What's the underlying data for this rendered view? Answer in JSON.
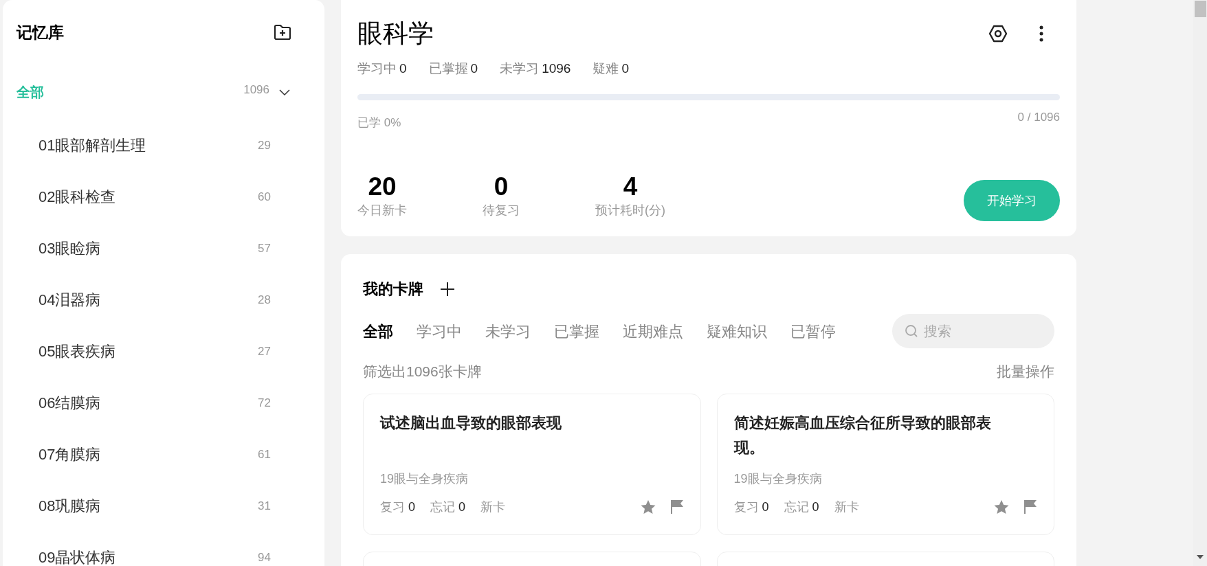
{
  "sidebar": {
    "title": "记忆库",
    "all": {
      "label": "全部",
      "count": "1096",
      "selected": true,
      "expanded": true
    },
    "items": [
      {
        "label": "01眼部解剖生理",
        "count": "29",
        "selected": false
      },
      {
        "label": "02眼科检查",
        "count": "60",
        "selected": false
      },
      {
        "label": "03眼睑病",
        "count": "57",
        "selected": false
      },
      {
        "label": "04泪器病",
        "count": "28",
        "selected": false
      },
      {
        "label": "05眼表疾病",
        "count": "27",
        "selected": false
      },
      {
        "label": "06结膜病",
        "count": "72",
        "selected": false
      },
      {
        "label": "07角膜病",
        "count": "61",
        "selected": false
      },
      {
        "label": "08巩膜病",
        "count": "31",
        "selected": false
      },
      {
        "label": "09晶状体病",
        "count": "94",
        "selected": false
      }
    ]
  },
  "deck": {
    "title": "眼科学",
    "stats": [
      {
        "label": "学习中",
        "value": "0"
      },
      {
        "label": "已掌握",
        "value": "0"
      },
      {
        "label": "未学习",
        "value": "1096"
      },
      {
        "label": "疑难",
        "value": "0"
      }
    ],
    "progress": {
      "level": 0,
      "learned": "已学 0%",
      "count": "0 / 1096"
    },
    "metrics": [
      {
        "value": "20",
        "label": "今日新卡"
      },
      {
        "value": "0",
        "label": "待复习"
      },
      {
        "value": "4",
        "label": "预计耗时(分)"
      }
    ],
    "start_button": "开始学习"
  },
  "cards_section": {
    "title": "我的卡牌",
    "tabs": [
      {
        "label": "全部",
        "selected": true
      },
      {
        "label": "学习中",
        "selected": false
      },
      {
        "label": "未学习",
        "selected": false
      },
      {
        "label": "已掌握",
        "selected": false
      },
      {
        "label": "近期难点",
        "selected": false
      },
      {
        "label": "疑难知识",
        "selected": false
      },
      {
        "label": "已暂停",
        "selected": false
      }
    ],
    "search": {
      "placeholder": "搜索"
    },
    "filter_text": "筛选出1096张卡牌",
    "bulk_action": "批量操作",
    "cards": [
      {
        "question": "试述脑出血导致的眼部表现",
        "category": "19眼与全身疾病",
        "review_label": "复习",
        "review_count": "0",
        "forget_label": "忘记",
        "forget_count": "0",
        "status": "新卡",
        "starred": false,
        "flagged": false
      },
      {
        "question": "简述妊娠高血压综合征所导致的眼部表现。",
        "category": "19眼与全身疾病",
        "review_label": "复习",
        "review_count": "0",
        "forget_label": "忘记",
        "forget_count": "0",
        "status": "新卡",
        "starred": false,
        "flagged": false
      }
    ]
  }
}
